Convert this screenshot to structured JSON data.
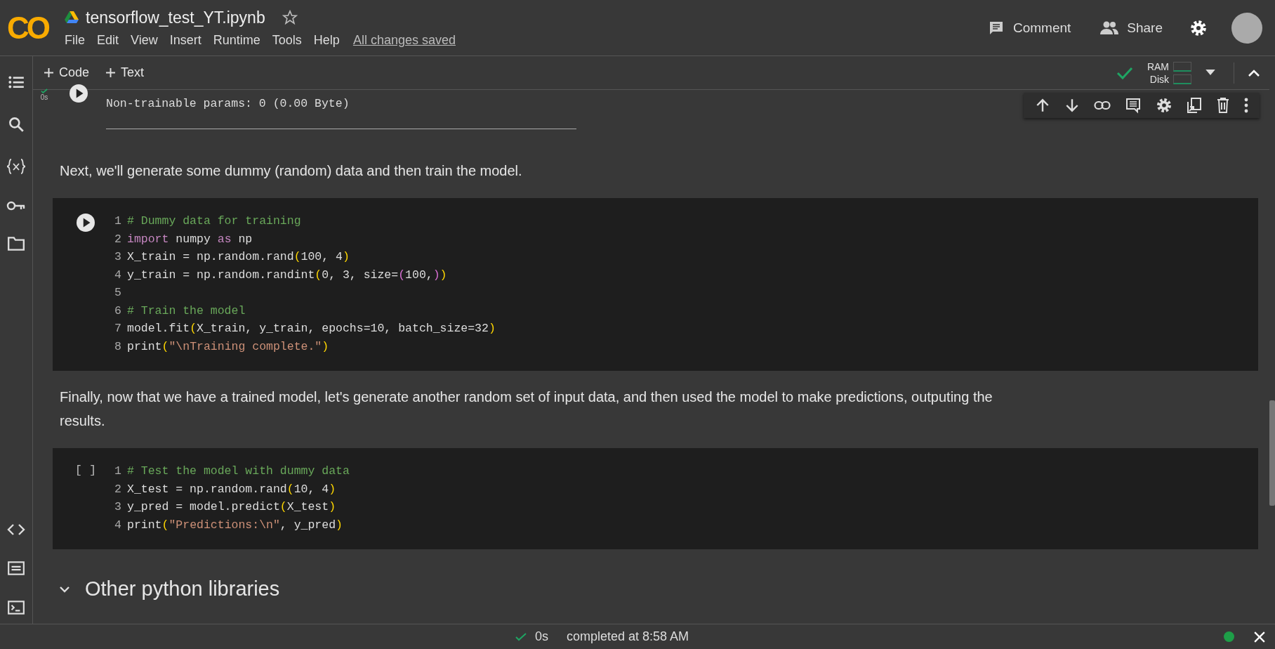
{
  "header": {
    "logo": "CO",
    "title": "tensorflow_test_YT.ipynb",
    "starred": false,
    "menu": [
      "File",
      "Edit",
      "View",
      "Insert",
      "Runtime",
      "Tools",
      "Help"
    ],
    "save_status": "All changes saved",
    "actions": [
      {
        "kind": "comment",
        "label": "Comment"
      },
      {
        "kind": "share",
        "label": "Share"
      }
    ]
  },
  "toolbar": {
    "add_buttons": [
      {
        "label": "Code"
      },
      {
        "label": "Text"
      }
    ],
    "connected": true,
    "ram_label": "RAM",
    "disk_label": "Disk"
  },
  "cells": [
    {
      "kind": "output",
      "exec_time": "0s",
      "done": true,
      "lines": [
        "Non-trainable params: 0 (0.00 Byte)"
      ]
    },
    {
      "kind": "markdown",
      "text": "Next, we'll generate some dummy (random) data and then train the model."
    },
    {
      "kind": "code",
      "focused": true,
      "lines": [
        {
          "number": "1",
          "tokens": [
            {
              "kind": "comment",
              "text": "# Dummy data for training"
            }
          ]
        },
        {
          "number": "2",
          "tokens": [
            {
              "kind": "keyword",
              "text": "import"
            },
            {
              "kind": "plain",
              "text": " numpy "
            },
            {
              "kind": "keyword",
              "text": "as"
            },
            {
              "kind": "plain",
              "text": " np"
            }
          ]
        },
        {
          "number": "3",
          "tokens": [
            {
              "kind": "plain",
              "text": "X_train = np.random.rand"
            },
            {
              "kind": "paren",
              "text": "("
            },
            {
              "kind": "plain",
              "text": "100, 4"
            },
            {
              "kind": "paren",
              "text": ")"
            }
          ]
        },
        {
          "number": "4",
          "tokens": [
            {
              "kind": "plain",
              "text": "y_train = np.random.randint"
            },
            {
              "kind": "paren",
              "text": "("
            },
            {
              "kind": "plain",
              "text": "0, 3, size="
            },
            {
              "kind": "bracket",
              "text": "("
            },
            {
              "kind": "plain",
              "text": "100,"
            },
            {
              "kind": "bracket",
              "text": ")"
            },
            {
              "kind": "paren",
              "text": ")"
            }
          ]
        },
        {
          "number": "5"
        },
        {
          "number": "6",
          "tokens": [
            {
              "kind": "comment",
              "text": "# Train the model"
            }
          ]
        },
        {
          "number": "7",
          "tokens": [
            {
              "kind": "plain",
              "text": "model.fit"
            },
            {
              "kind": "paren",
              "text": "("
            },
            {
              "kind": "plain",
              "text": "X_train, y_train, epochs=10, batch_size=32"
            },
            {
              "kind": "paren",
              "text": ")"
            }
          ]
        },
        {
          "number": "8",
          "tokens": [
            {
              "kind": "plain",
              "text": "print"
            },
            {
              "kind": "paren",
              "text": "("
            },
            {
              "kind": "string",
              "text": "\"\\nTraining complete.\""
            },
            {
              "kind": "paren",
              "text": ")"
            }
          ]
        }
      ]
    },
    {
      "kind": "markdown",
      "text": "Finally, now that we have a trained model, let's generate another random set of input data, and then used the model to make predictions, outputing the results."
    },
    {
      "kind": "code",
      "focused": false,
      "prompt": "[ ]",
      "lines": [
        {
          "number": "1",
          "tokens": [
            {
              "kind": "comment",
              "text": "# Test the model with dummy data"
            }
          ]
        },
        {
          "number": "2",
          "tokens": [
            {
              "kind": "plain",
              "text": "X_test = np.random.rand"
            },
            {
              "kind": "paren",
              "text": "("
            },
            {
              "kind": "plain",
              "text": "10, 4"
            },
            {
              "kind": "paren",
              "text": ")"
            }
          ]
        },
        {
          "number": "3",
          "tokens": [
            {
              "kind": "plain",
              "text": "y_pred = model.predict"
            },
            {
              "kind": "paren",
              "text": "("
            },
            {
              "kind": "plain",
              "text": "X_test"
            },
            {
              "kind": "paren",
              "text": ")"
            }
          ]
        },
        {
          "number": "4",
          "tokens": [
            {
              "kind": "plain",
              "text": "print"
            },
            {
              "kind": "paren",
              "text": "("
            },
            {
              "kind": "string",
              "text": "\"Predictions:\\n\""
            },
            {
              "kind": "plain",
              "text": ", y_pred"
            },
            {
              "kind": "paren",
              "text": ")"
            }
          ]
        }
      ]
    },
    {
      "kind": "heading",
      "text": "Other python libraries",
      "expanded": true
    }
  ],
  "status_bar": {
    "done": true,
    "time": "0s",
    "message": "completed at 8:58 AM",
    "connected": true
  }
}
